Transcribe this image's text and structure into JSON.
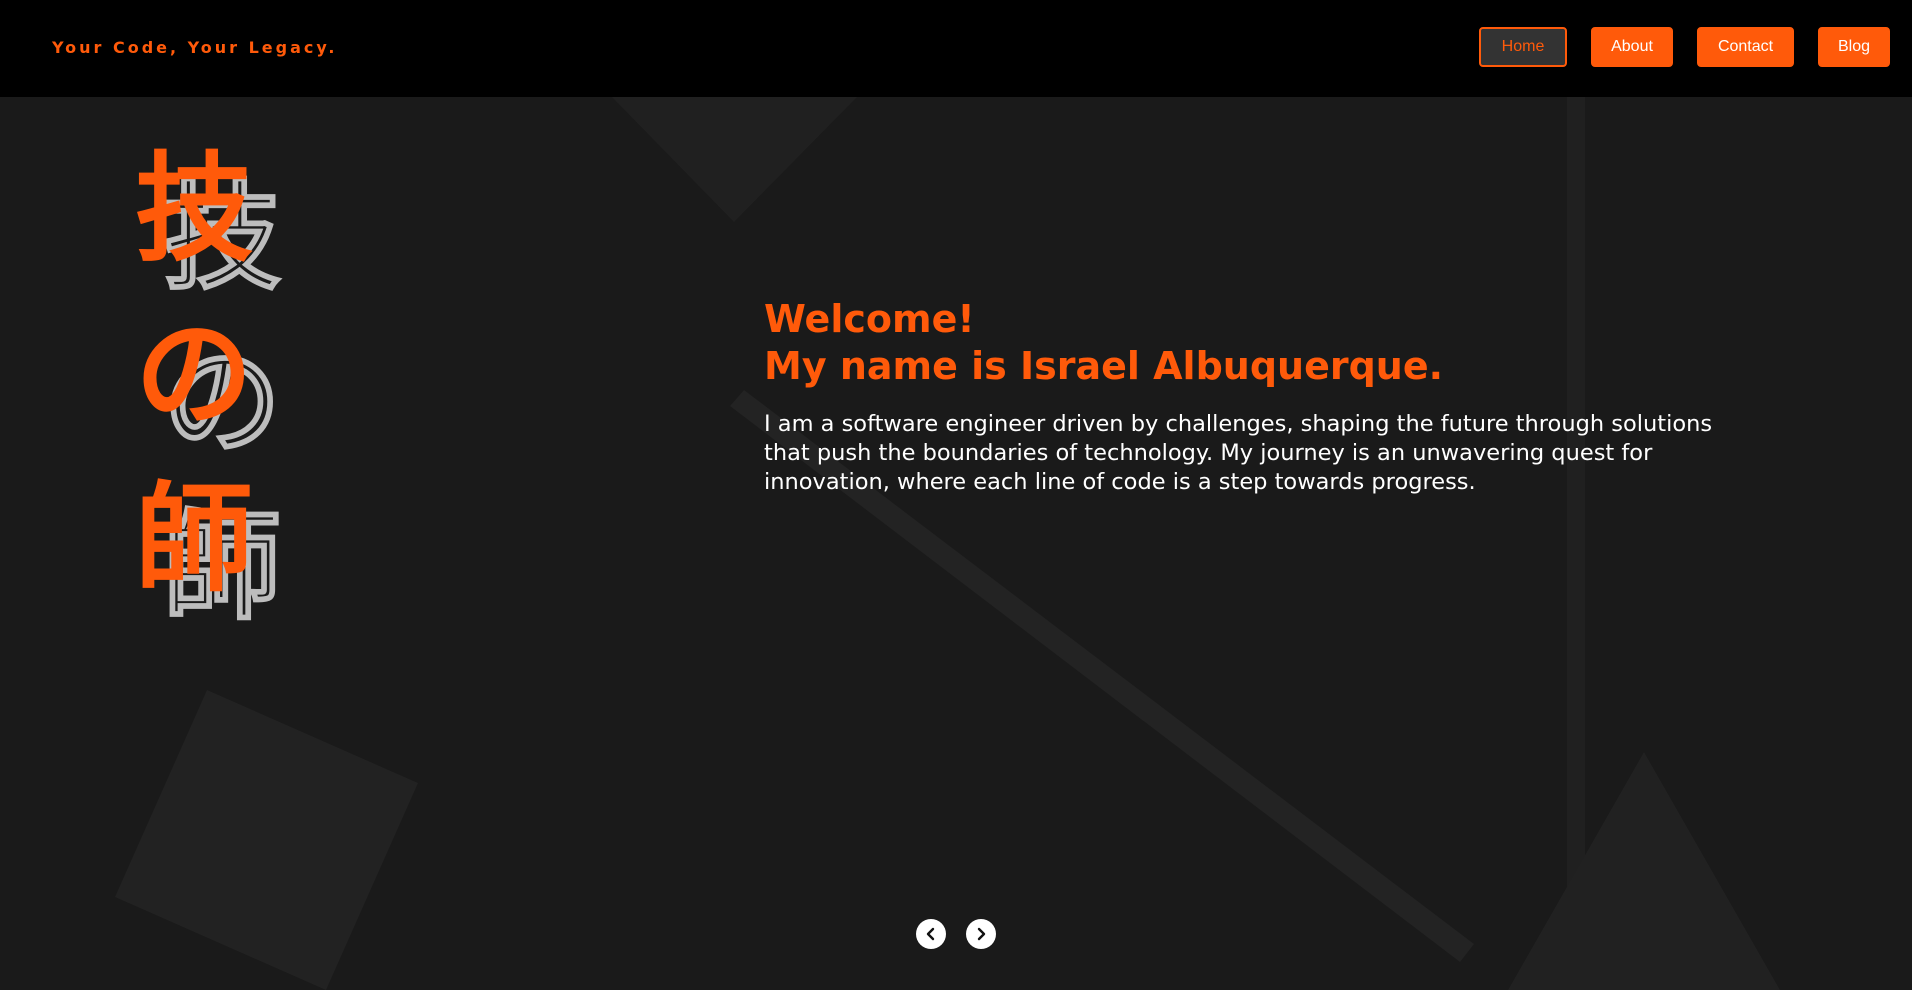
{
  "header": {
    "tagline": "Your Code, Your Legacy.",
    "nav": [
      {
        "label": "Home",
        "active": true
      },
      {
        "label": "About",
        "active": false
      },
      {
        "label": "Contact",
        "active": false
      },
      {
        "label": "Blog",
        "active": false
      }
    ]
  },
  "hero": {
    "kanji": [
      "技",
      "の",
      "師"
    ],
    "welcome_line1": "Welcome!",
    "welcome_line2": "My name is Israel Albuquerque.",
    "intro": "I am a software engineer driven by challenges, shaping the future through solutions that push the boundaries of technology. My journey is an unwavering quest for innovation, where each line of code is a step towards progress."
  },
  "carousel": {
    "prev_icon": "chevron-left-icon",
    "next_icon": "chevron-right-icon"
  },
  "colors": {
    "accent": "#ff5a0a",
    "background": "#1a1a1a",
    "header": "#000000",
    "text": "#ffffff",
    "outline": "#bdbdbd"
  }
}
